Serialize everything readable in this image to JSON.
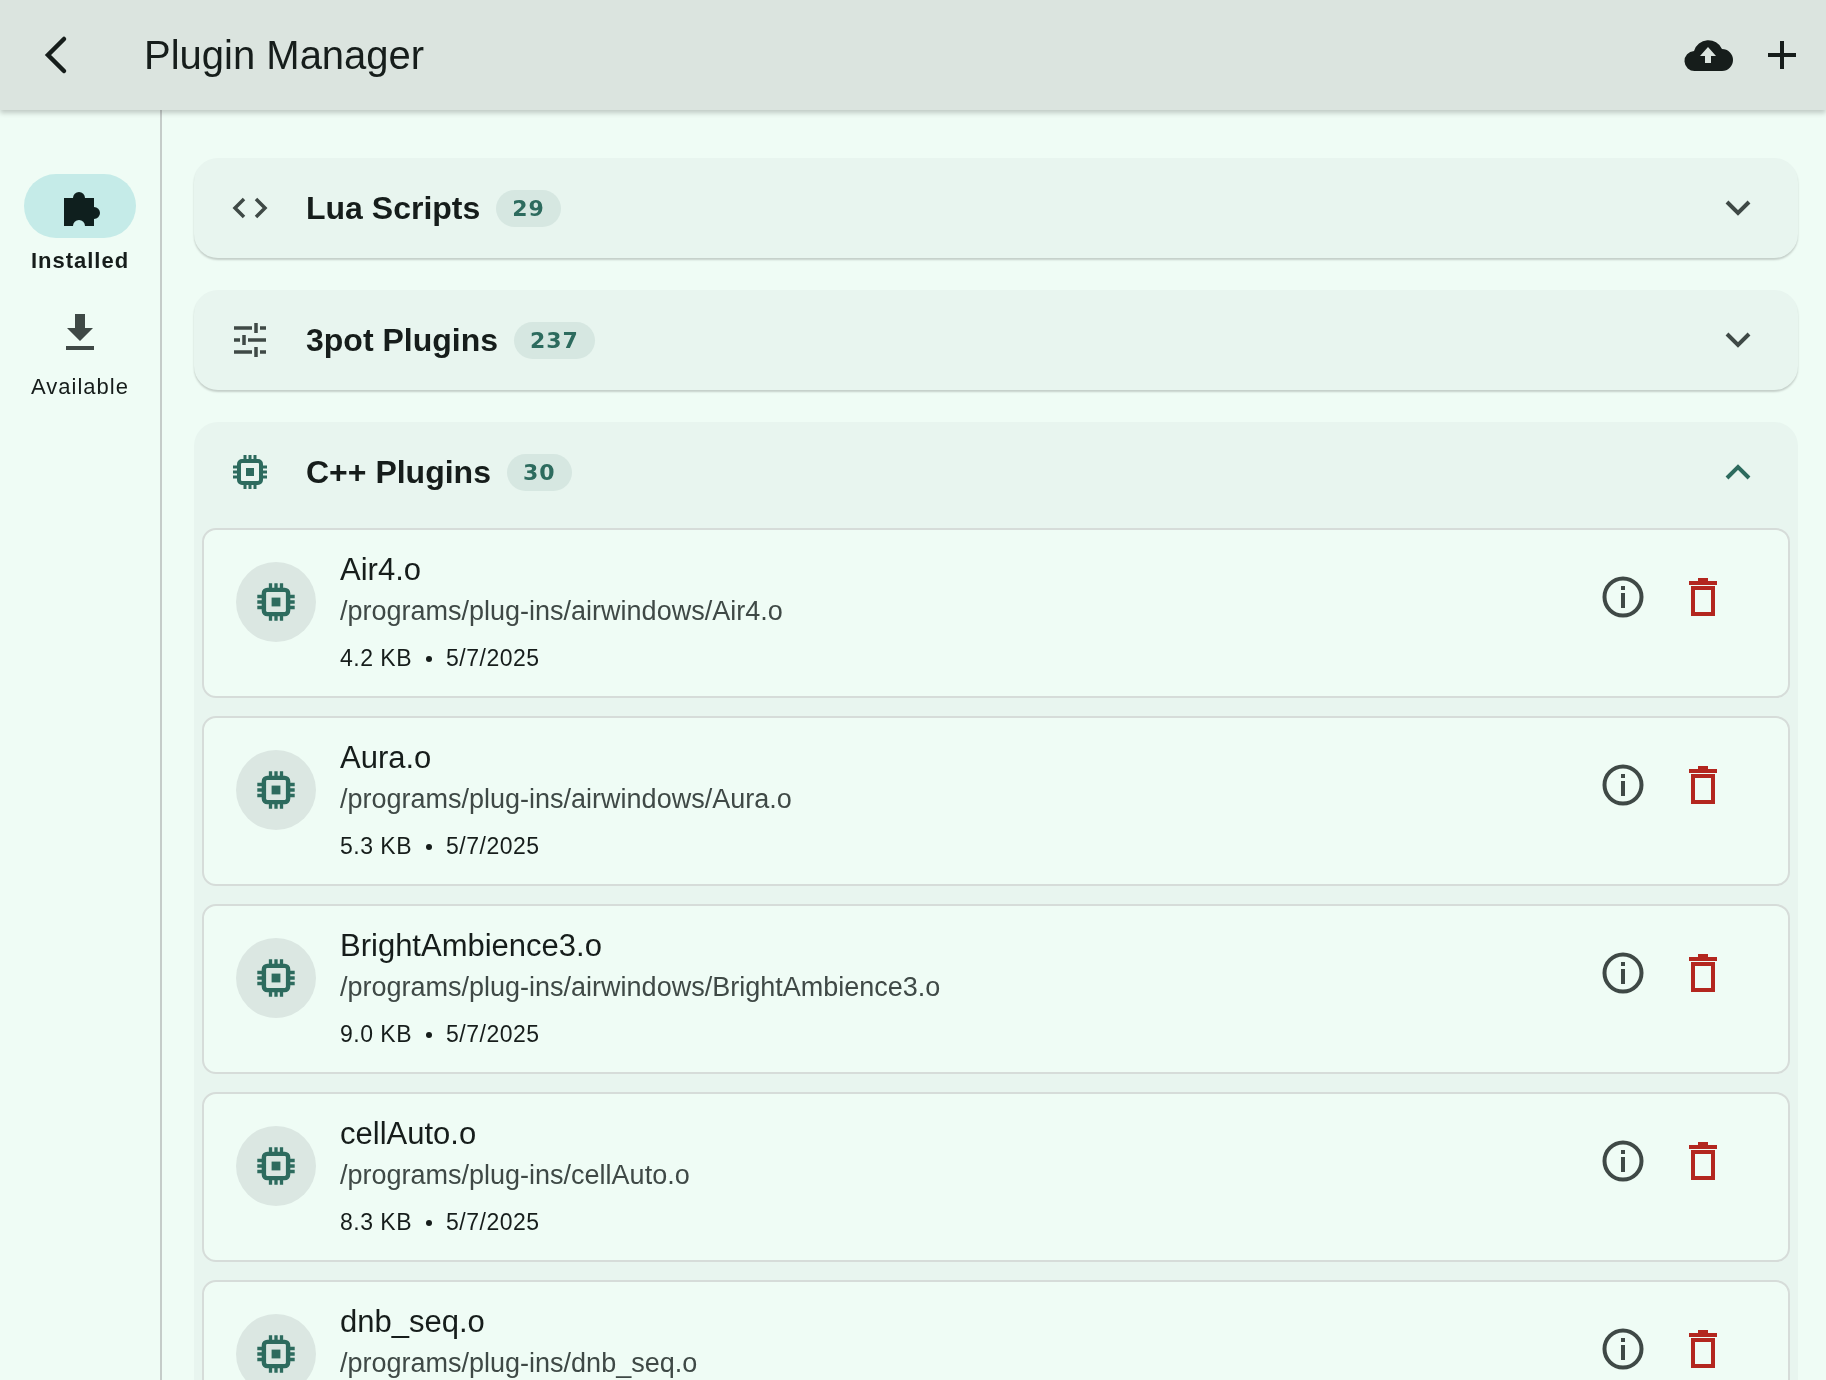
{
  "app_bar": {
    "title": "Plugin Manager"
  },
  "nav": [
    {
      "label": "Installed",
      "kind": "puzzle",
      "selected": true
    },
    {
      "label": "Available",
      "kind": "download",
      "selected": false
    }
  ],
  "sections": [
    {
      "title": "Lua Scripts",
      "count": "29",
      "kind": "code",
      "expanded": false
    },
    {
      "title": "3pot Plugins",
      "count": "237",
      "kind": "tune",
      "expanded": false
    },
    {
      "title": "C++ Plugins",
      "count": "30",
      "kind": "chip",
      "expanded": true,
      "plugins": [
        {
          "name": "Air4.o",
          "path": "/programs/plug-ins/airwindows/Air4.o",
          "size": "4.2 KB",
          "date": "5/7/2025"
        },
        {
          "name": "Aura.o",
          "path": "/programs/plug-ins/airwindows/Aura.o",
          "size": "5.3 KB",
          "date": "5/7/2025"
        },
        {
          "name": "BrightAmbience3.o",
          "path": "/programs/plug-ins/airwindows/BrightAmbience3.o",
          "size": "9.0 KB",
          "date": "5/7/2025"
        },
        {
          "name": "cellAuto.o",
          "path": "/programs/plug-ins/cellAuto.o",
          "size": "8.3 KB",
          "date": "5/7/2025"
        },
        {
          "name": "dnb_seq.o",
          "path": "/programs/plug-ins/dnb_seq.o"
        }
      ]
    }
  ]
}
